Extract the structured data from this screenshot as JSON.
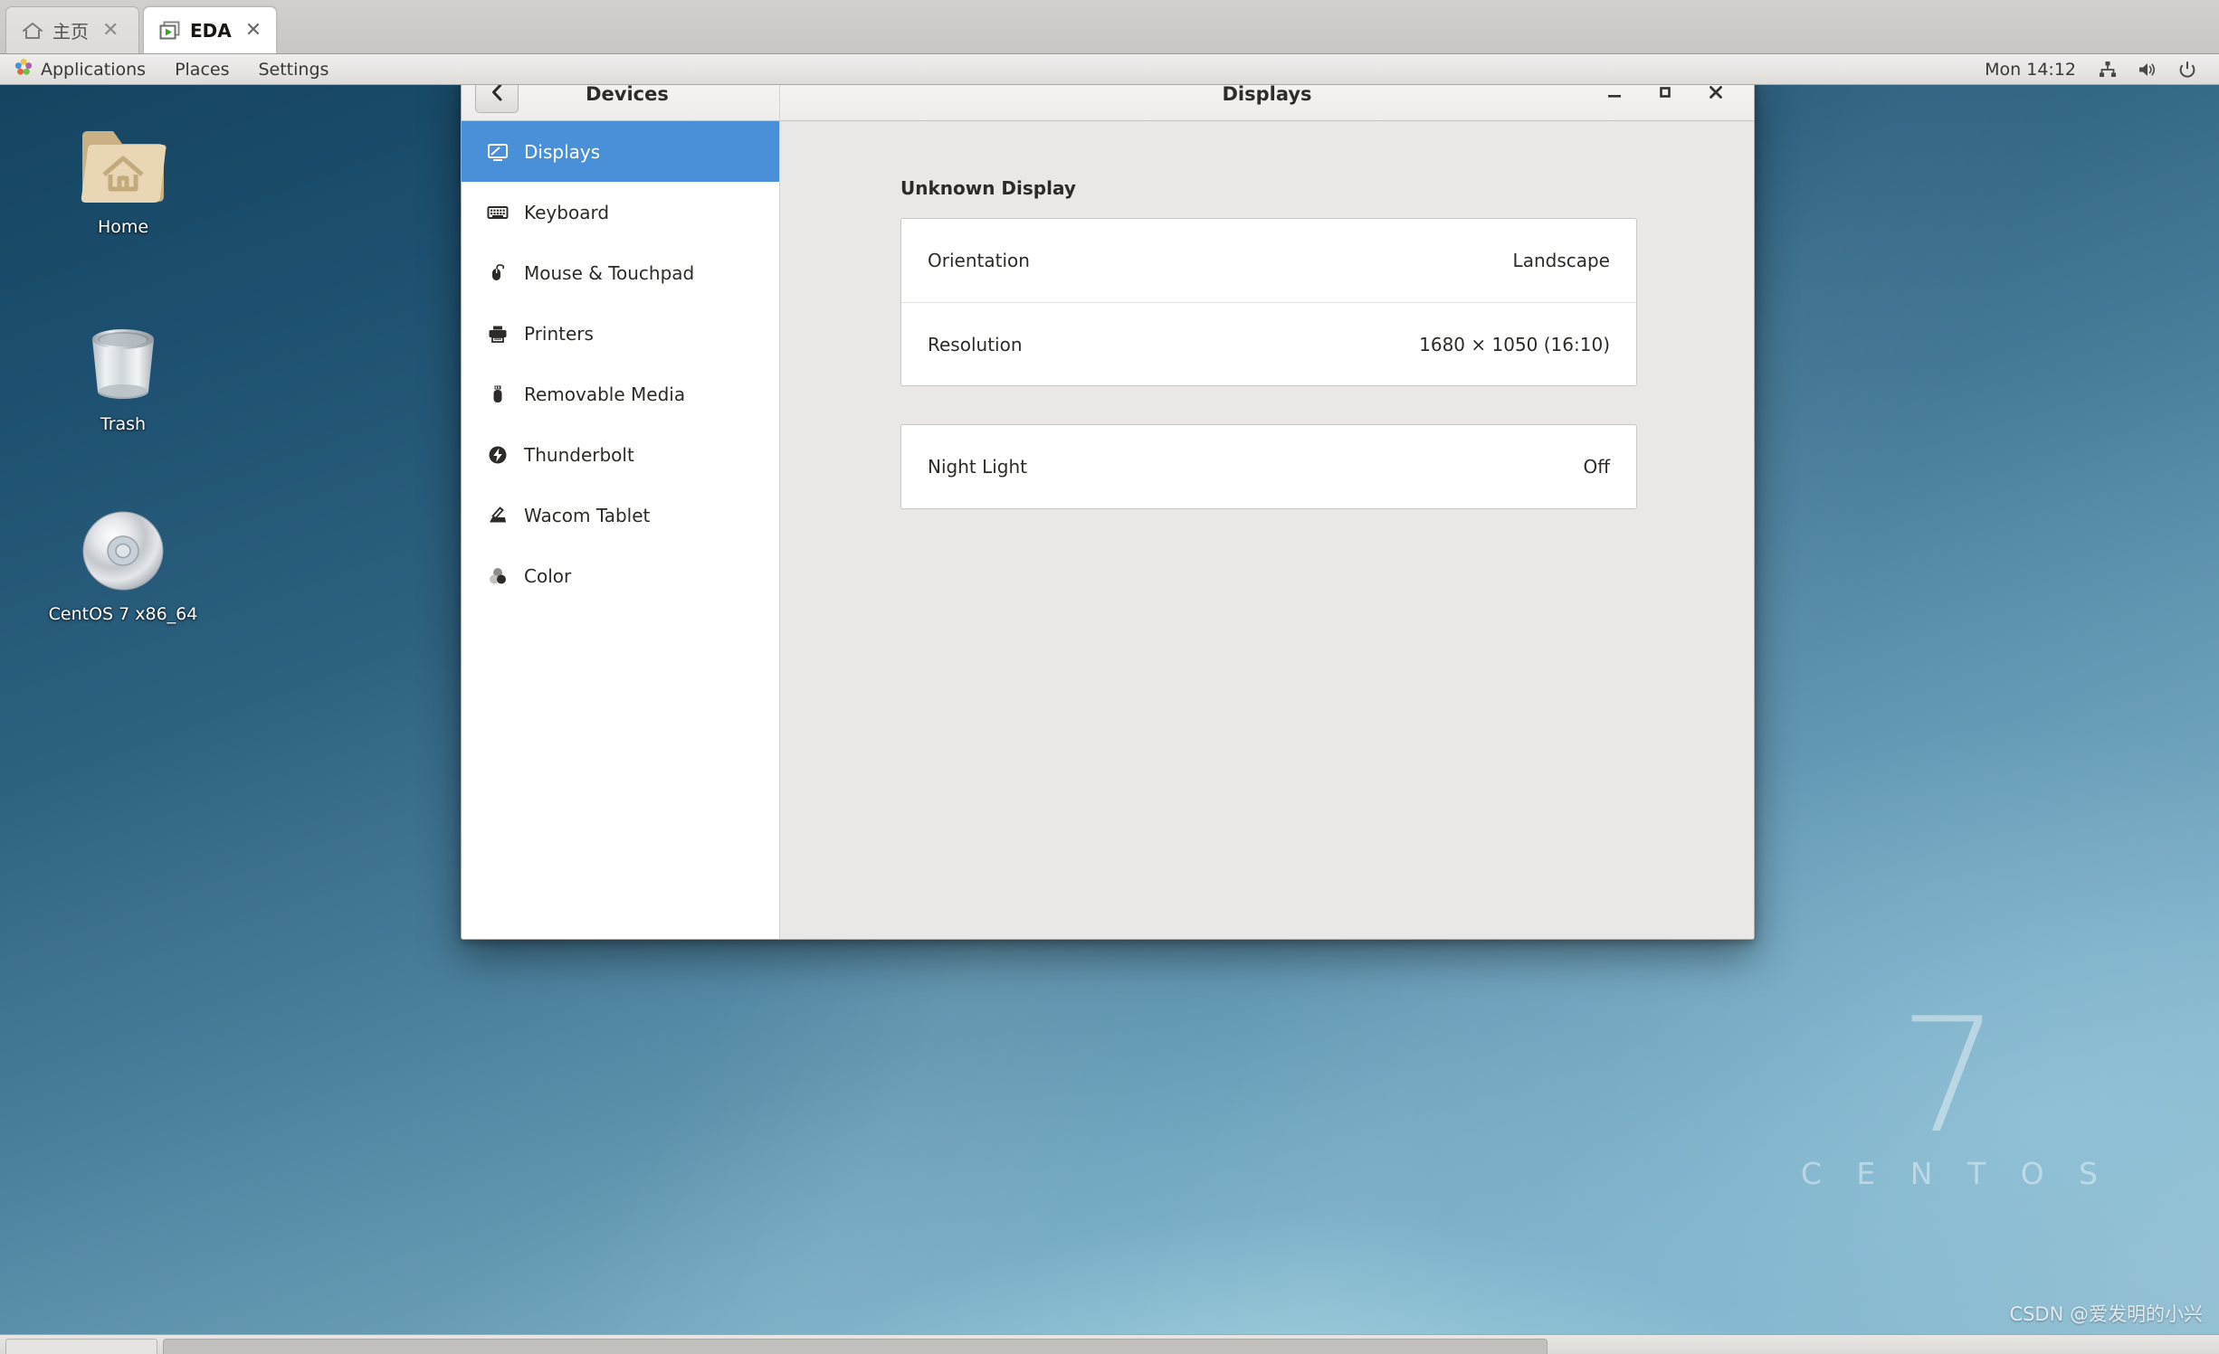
{
  "browser_tabs": [
    {
      "label": "主页",
      "icon": "home-icon",
      "active": false,
      "close": "✕"
    },
    {
      "label": "EDA",
      "icon": "window-play-icon",
      "active": true,
      "close": "✕"
    }
  ],
  "panel": {
    "menus": [
      {
        "label": "Applications",
        "icon": "gnome-footprint-icon"
      },
      {
        "label": "Places",
        "icon": null
      },
      {
        "label": "Settings",
        "icon": null
      }
    ],
    "clock": "Mon 14:12",
    "tray": [
      {
        "name": "network-icon"
      },
      {
        "name": "volume-icon"
      },
      {
        "name": "power-icon"
      }
    ]
  },
  "desktop": {
    "icons": [
      {
        "label": "Home",
        "icon": "home-folder-icon"
      },
      {
        "label": "Trash",
        "icon": "trash-icon"
      },
      {
        "label": "CentOS 7 x86_64",
        "icon": "cd-disc-icon"
      }
    ],
    "watermark": {
      "numeral": "7",
      "word": "C E N T O S"
    },
    "credit": "CSDN @爱发明的小兴"
  },
  "window": {
    "sidebar_title": "Devices",
    "content_title": "Displays",
    "back_icon": "chevron-left-icon",
    "controls": [
      {
        "name": "minimize-button",
        "glyph": "minimize-icon"
      },
      {
        "name": "maximize-button",
        "glyph": "maximize-icon"
      },
      {
        "name": "close-button",
        "glyph": "close-icon"
      }
    ],
    "sidebar_items": [
      {
        "label": "Displays",
        "icon": "display-icon",
        "selected": true
      },
      {
        "label": "Keyboard",
        "icon": "keyboard-icon",
        "selected": false
      },
      {
        "label": "Mouse & Touchpad",
        "icon": "mouse-icon",
        "selected": false
      },
      {
        "label": "Printers",
        "icon": "printer-icon",
        "selected": false
      },
      {
        "label": "Removable Media",
        "icon": "usb-drive-icon",
        "selected": false
      },
      {
        "label": "Thunderbolt",
        "icon": "thunderbolt-icon",
        "selected": false
      },
      {
        "label": "Wacom Tablet",
        "icon": "wacom-tablet-icon",
        "selected": false
      },
      {
        "label": "Color",
        "icon": "color-icon",
        "selected": false
      }
    ],
    "content": {
      "section_title": "Unknown Display",
      "display_rows": [
        {
          "label": "Orientation",
          "value": "Landscape"
        },
        {
          "label": "Resolution",
          "value": "1680 × 1050 (16:10)"
        }
      ],
      "night_light_row": {
        "label": "Night Light",
        "value": "Off"
      }
    }
  },
  "colors": {
    "selection_blue": "#4a90d9",
    "content_bg": "#e9e8e7",
    "card_bg": "#ffffff"
  }
}
